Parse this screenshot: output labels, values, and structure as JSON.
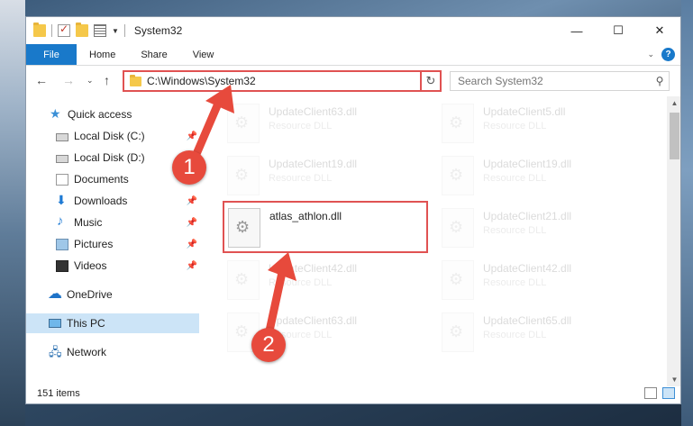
{
  "window": {
    "title": "System32",
    "controls": {
      "minimize": "—",
      "maximize": "☐",
      "close": "✕"
    }
  },
  "ribbon": {
    "tabs": [
      "File",
      "Home",
      "Share",
      "View"
    ],
    "help": "?"
  },
  "address": {
    "path": "C:\\Windows\\System32",
    "search_placeholder": "Search System32"
  },
  "nav": {
    "items": [
      {
        "label": "Quick access",
        "icon": "quick-access-icon",
        "pinned": false
      },
      {
        "label": "Local Disk (C:)",
        "icon": "disk-icon",
        "pinned": true
      },
      {
        "label": "Local Disk (D:)",
        "icon": "disk-icon",
        "pinned": false
      },
      {
        "label": "Documents",
        "icon": "documents-icon",
        "pinned": false
      },
      {
        "label": "Downloads",
        "icon": "downloads-icon",
        "pinned": true
      },
      {
        "label": "Music",
        "icon": "music-icon",
        "pinned": true
      },
      {
        "label": "Pictures",
        "icon": "pictures-icon",
        "pinned": true
      },
      {
        "label": "Videos",
        "icon": "videos-icon",
        "pinned": true
      },
      {
        "label": "OneDrive",
        "icon": "onedrive-icon",
        "pinned": false
      },
      {
        "label": "This PC",
        "icon": "this-pc-icon",
        "pinned": false,
        "selected": true
      },
      {
        "label": "Network",
        "icon": "network-icon",
        "pinned": false
      }
    ]
  },
  "files": {
    "left_column": [
      {
        "name": "UpdateClient63.dll",
        "type": "Resource DLL"
      },
      {
        "name": "UpdateClient19.dll",
        "type": "Resource DLL"
      },
      {
        "name": "atlas_athlon.dll",
        "type": "",
        "highlighted": true
      },
      {
        "name": "UpdateClient42.dll",
        "type": "Resource DLL"
      },
      {
        "name": "UpdateClient63.dll",
        "type": "Resource DLL"
      }
    ],
    "right_column": [
      {
        "name": "UpdateClient5.dll",
        "type": "Resource DLL"
      },
      {
        "name": "UpdateClient19.dll",
        "type": "Resource DLL"
      },
      {
        "name": "UpdateClient21.dll",
        "type": "Resource DLL"
      },
      {
        "name": "UpdateClient42.dll",
        "type": "Resource DLL"
      },
      {
        "name": "UpdateClient65.dll",
        "type": "Resource DLL"
      }
    ]
  },
  "status": {
    "item_count": "151 items"
  },
  "annotations": {
    "step1": "1",
    "step2": "2",
    "color": "#e74a3c"
  }
}
